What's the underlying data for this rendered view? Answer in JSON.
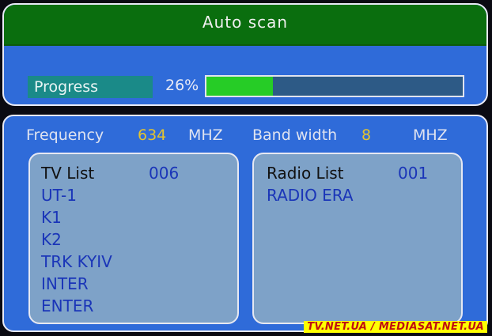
{
  "header": {
    "title": "Auto scan"
  },
  "progress": {
    "label": "Progress",
    "percent_text": "26%",
    "value": 0.26
  },
  "params": {
    "frequency_label": "Frequency",
    "frequency_value": "634",
    "frequency_unit": "MHZ",
    "bandwidth_label": "Band width",
    "bandwidth_value": "8",
    "bandwidth_unit": "MHZ"
  },
  "tv_list": {
    "title": "TV List",
    "count": "006",
    "items": [
      "UT-1",
      "K1",
      "K2",
      "TRK KYIV",
      "INTER",
      "ENTER"
    ]
  },
  "radio_list": {
    "title": "Radio List",
    "count": "001",
    "items": [
      "RADIO ERA"
    ]
  },
  "watermark": {
    "text": "TV.NET.UA / MEDIASAT.NET.UA"
  },
  "colors": {
    "panel_blue": "#2f6bd9",
    "title_green": "#0a6e0e",
    "progress_fill": "#26cc26",
    "value_yellow": "#e4c42e",
    "list_item_blue": "#1a35b8"
  }
}
